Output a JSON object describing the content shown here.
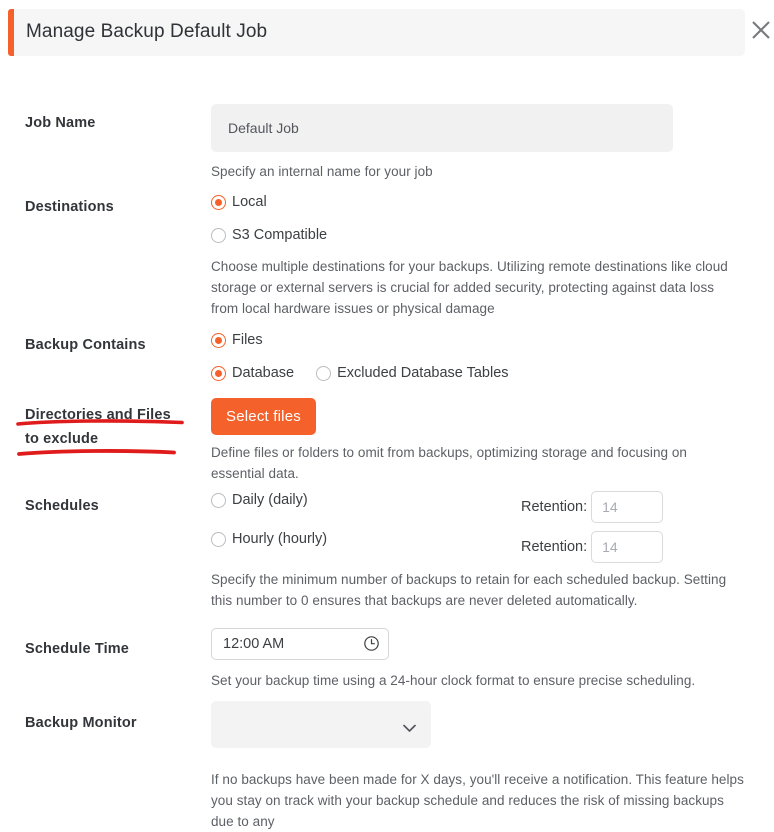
{
  "modal": {
    "title": "Manage Backup Default Job",
    "close_icon": "close-icon",
    "accent_color": "#f4612a"
  },
  "fields": {
    "job_name": {
      "label": "Job Name",
      "value": "Default Job",
      "hint": "Specify an internal name for your job"
    },
    "destinations": {
      "label": "Destinations",
      "options": [
        {
          "label": "Local",
          "checked": true
        },
        {
          "label": "S3 Compatible",
          "checked": false
        }
      ],
      "hint": "Choose multiple destinations for your backups. Utilizing remote destinations like cloud storage or external servers is crucial for added security, protecting against data loss from local hardware issues or physical damage"
    },
    "backup_contains": {
      "label": "Backup Contains",
      "options": [
        {
          "label": "Files",
          "checked": true
        },
        {
          "label": "Database",
          "checked": true
        },
        {
          "label": "Excluded Database Tables",
          "checked": false
        }
      ]
    },
    "exclude": {
      "label_line1": "Directories and Files",
      "label_line2": "to exclude",
      "button_label": "Select files",
      "hint": "Define files or folders to omit from backups, optimizing storage and focusing on essential data."
    },
    "schedules": {
      "label": "Schedules",
      "options": [
        {
          "label": "Daily (daily)",
          "checked": false,
          "retention_label": "Retention:",
          "retention_placeholder": "14",
          "retention_value": ""
        },
        {
          "label": "Hourly (hourly)",
          "checked": false,
          "retention_label": "Retention:",
          "retention_placeholder": "14",
          "retention_value": ""
        }
      ],
      "hint": "Specify the minimum number of backups to retain for each scheduled backup. Setting this number to 0 ensures that backups are never deleted automatically."
    },
    "schedule_time": {
      "label": "Schedule Time",
      "value": "12:00 AM",
      "icon": "clock-icon",
      "hint": "Set your backup time using a 24-hour clock format to ensure precise scheduling."
    },
    "backup_monitor": {
      "label": "Backup Monitor",
      "value": "",
      "icon": "chevron-down-icon",
      "hint": "If no backups have been made for X days, you'll receive a notification. This feature helps you stay on track with your backup schedule and reduces the risk of missing backups due to any"
    }
  },
  "annotations": {
    "color": "#e01b1b",
    "underline_count": 2
  }
}
